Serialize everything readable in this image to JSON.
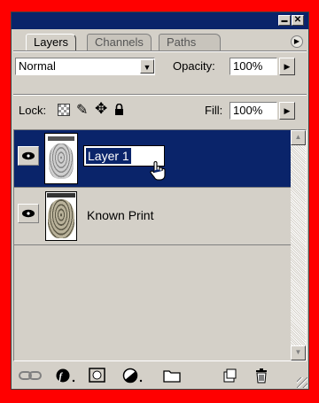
{
  "window": {
    "minimize_glyph": "▬",
    "close_glyph": "✕",
    "title_color": "#0a246a"
  },
  "tabs": [
    {
      "label": "Layers",
      "active": true
    },
    {
      "label": "Channels",
      "active": false
    },
    {
      "label": "Paths",
      "active": false
    }
  ],
  "panel_menu_icon": "flyout-menu-arrow-icon",
  "blend_mode": {
    "value": "Normal"
  },
  "opacity": {
    "label": "Opacity:",
    "value": "100%"
  },
  "lock": {
    "label": "Lock:",
    "icons": [
      "lock-transparent-pixels-icon",
      "lock-image-pixels-icon",
      "lock-position-icon",
      "lock-all-icon"
    ]
  },
  "fill": {
    "label": "Fill:",
    "value": "100%"
  },
  "layers": [
    {
      "name": "Layer 1",
      "selected": true,
      "visible": true,
      "editing_name": true
    },
    {
      "name": "Known Print",
      "selected": false,
      "visible": true,
      "editing_name": false
    }
  ],
  "bottom_icons": [
    "link-layers-icon",
    "layer-style-icon",
    "add-mask-icon",
    "new-adjustment-layer-icon",
    "new-group-icon",
    "new-layer-icon",
    "delete-layer-icon"
  ],
  "colors": {
    "selection": "#0a246a",
    "frame": "#ff0000",
    "panel": "#d4d0c8"
  }
}
